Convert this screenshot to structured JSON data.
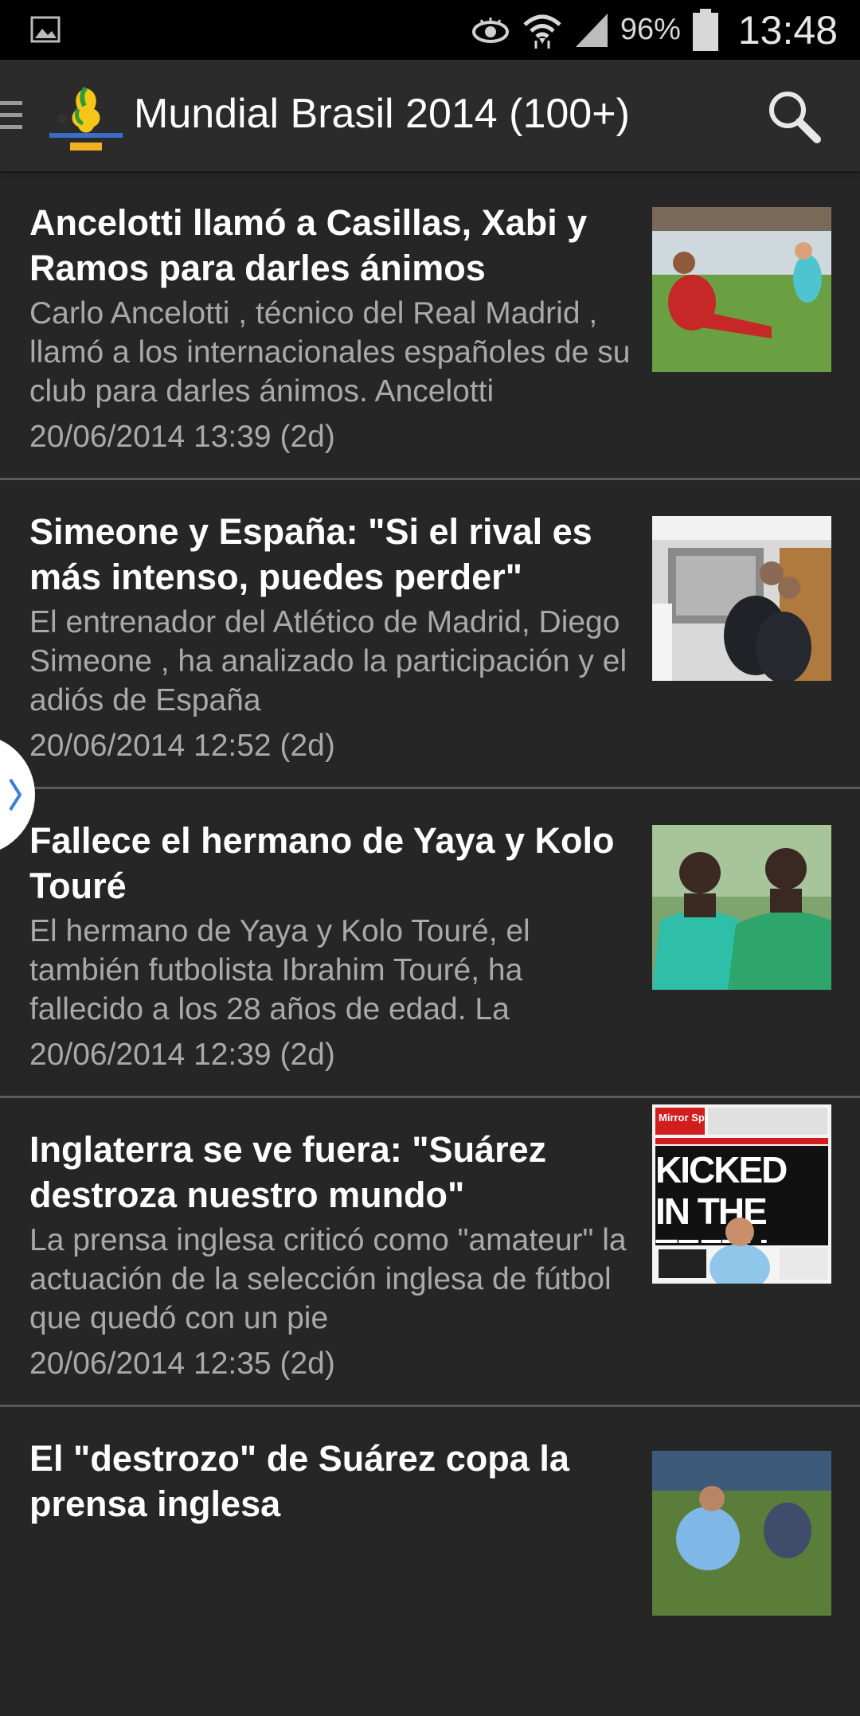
{
  "status_bar": {
    "battery": "96%",
    "time": "13:48"
  },
  "app_bar": {
    "title": "Mundial Brasil 2014 (100+)",
    "icons": [
      "drawer-icon",
      "app-logo",
      "search-icon"
    ]
  },
  "articles": [
    {
      "headline": "Ancelotti llamó a Casillas, Xabi y Ramos para darles ánimos",
      "summary": "Carlo Ancelotti , técnico del Real Madrid , llamó a los internacionales españoles de su club para darles ánimos. Ancelotti",
      "date": "20/06/2014 13:39 (2d)"
    },
    {
      "headline": "Simeone y España: \"Si el rival es más intenso, puedes perder\"",
      "summary": "El entrenador del Atlético de Madrid, Diego Simeone , ha analizado la participación y el adiós de España",
      "date": "20/06/2014 12:52 (2d)"
    },
    {
      "headline": "Fallece el hermano de Yaya y Kolo Touré",
      "summary": "El hermano de Yaya y Kolo Touré, el también futbolista Ibrahim Touré, ha fallecido a los 28 años de edad. La",
      "date": "20/06/2014 12:39 (2d)"
    },
    {
      "headline": "Inglaterra se ve fuera: \"Suárez destroza nuestro mundo\"",
      "summary": "La prensa inglesa criticó como \"amateur\" la actuación de la selección inglesa de fútbol que quedó con un pie",
      "date": "20/06/2014 12:35 (2d)",
      "thumb_text": {
        "masthead": "Mirror Sport",
        "headline": "KICKED IN THE TEETH"
      }
    },
    {
      "headline": "El \"destrozo\" de Suárez copa la prensa inglesa"
    }
  ]
}
